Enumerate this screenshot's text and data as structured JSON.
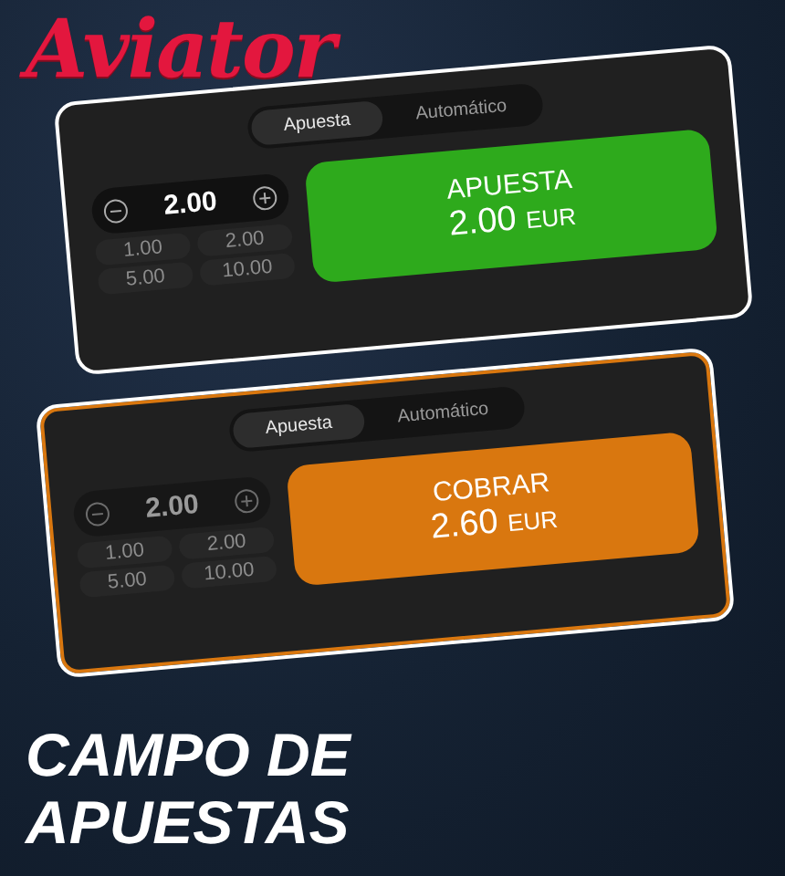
{
  "logo": {
    "text": "Aviator"
  },
  "panels": [
    {
      "kind": "bet",
      "tabs": [
        {
          "label": "Apuesta",
          "selected": true
        },
        {
          "label": "Automático",
          "selected": false
        }
      ],
      "stepper": {
        "value": "2.00",
        "disabled": false
      },
      "amounts": [
        "1.00",
        "2.00",
        "5.00",
        "10.00"
      ],
      "action": {
        "label": "APUESTA",
        "amount": "2.00",
        "currency": "EUR"
      }
    },
    {
      "kind": "cashout",
      "tabs": [
        {
          "label": "Apuesta",
          "selected": true
        },
        {
          "label": "Automático",
          "selected": false
        }
      ],
      "stepper": {
        "value": "2.00",
        "disabled": true
      },
      "amounts": [
        "1.00",
        "2.00",
        "5.00",
        "10.00"
      ],
      "action": {
        "label": "COBRAR",
        "amount": "2.60",
        "currency": "EUR"
      }
    }
  ],
  "headline": [
    "CAMPO DE",
    "APUESTAS"
  ]
}
